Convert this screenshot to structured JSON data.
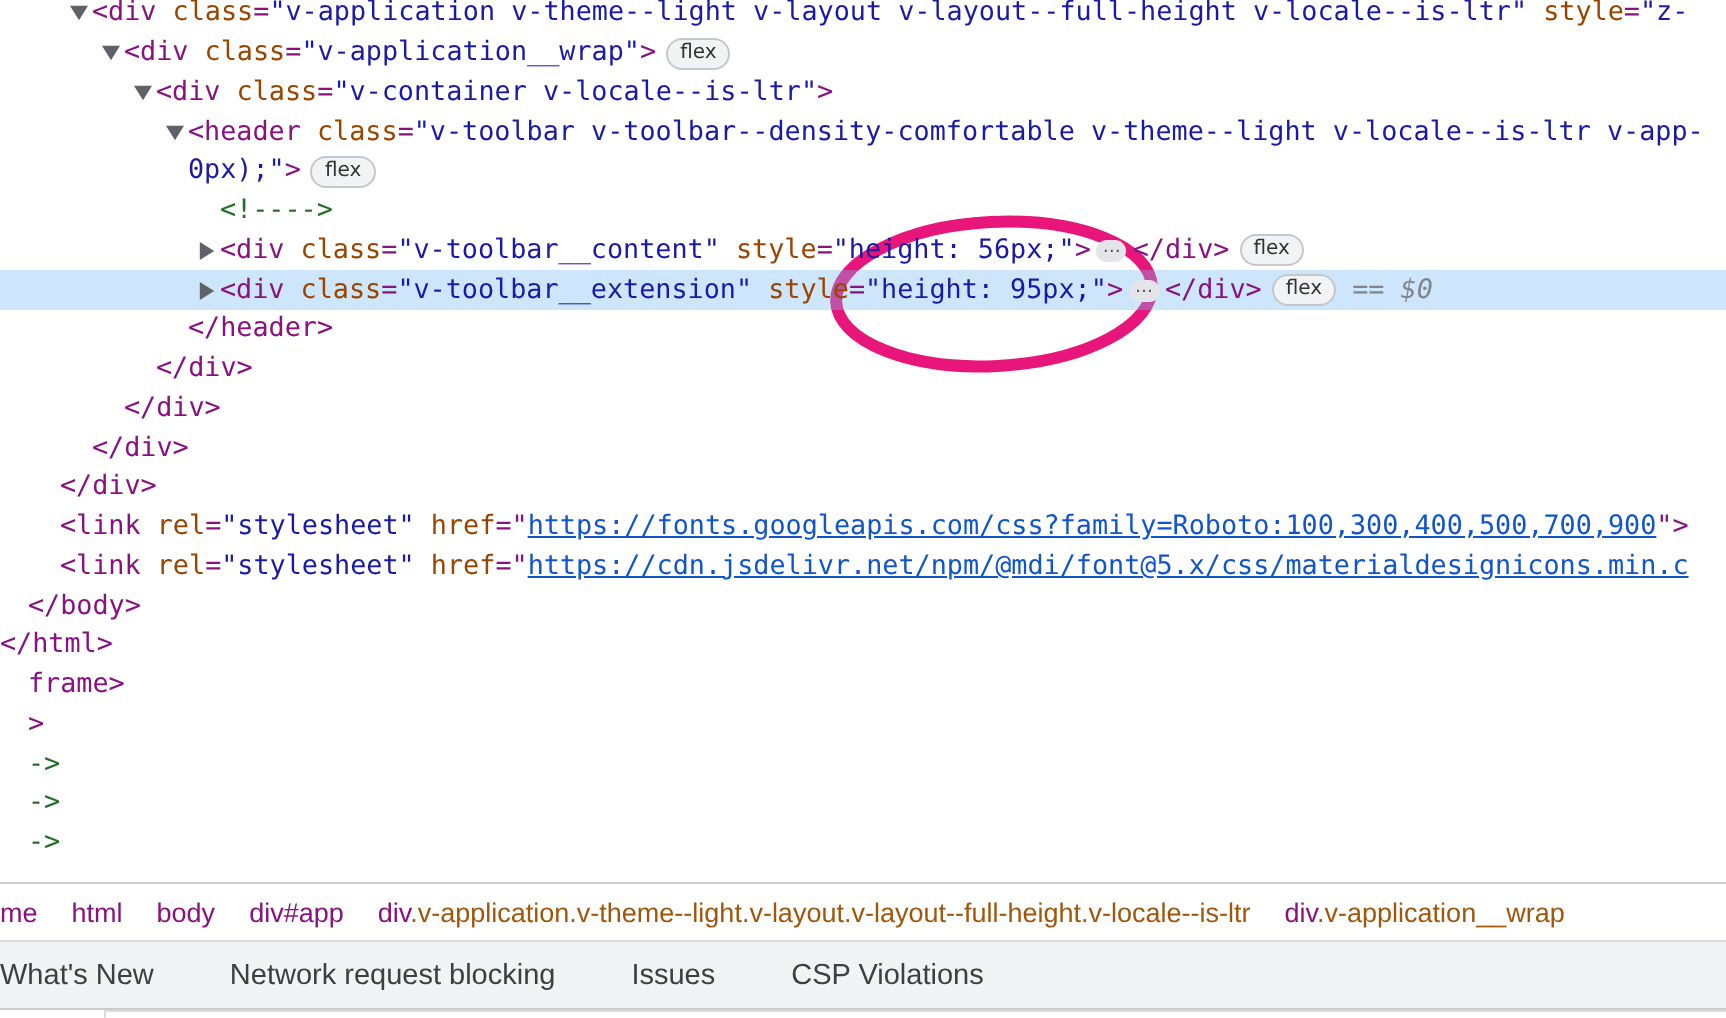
{
  "tree": [
    {
      "close": [
        {
          "kind": "tag",
          "text": "</html>"
        }
      ],
      "children": [
        {
          "close": [
            {
              "kind": "tag",
              "text": "</body>"
            }
          ],
          "children": [
            {
              "close": [
                {
                  "kind": "tag",
                  "text": "</div>"
                }
              ],
              "children": [
                {
                  "selected": false,
                  "expanded": true,
                  "open": [
                    {
                      "kind": "tag",
                      "text": "<div"
                    },
                    {
                      "kind": "attr",
                      "text": " class"
                    },
                    {
                      "kind": "tag",
                      "text": "="
                    },
                    {
                      "kind": "value",
                      "text": "\"v-application v-theme--light v-layout v-layout--full-height v-locale--is-ltr\""
                    },
                    {
                      "kind": "attr",
                      "text": " style"
                    },
                    {
                      "kind": "tag",
                      "text": "="
                    },
                    {
                      "kind": "value",
                      "text": "\"z-"
                    }
                  ],
                  "close": [
                    {
                      "kind": "tag",
                      "text": "</div>"
                    }
                  ],
                  "children": [
                    {
                      "selected": false,
                      "expanded": true,
                      "open": [
                        {
                          "kind": "tag",
                          "text": "<div"
                        },
                        {
                          "kind": "attr",
                          "text": " class"
                        },
                        {
                          "kind": "tag",
                          "text": "="
                        },
                        {
                          "kind": "value",
                          "text": "\"v-application__wrap\""
                        },
                        {
                          "kind": "tag",
                          "text": ">"
                        },
                        {
                          "kind": "badge",
                          "text": "flex"
                        }
                      ],
                      "close": [
                        {
                          "kind": "tag",
                          "text": "</div>"
                        }
                      ],
                      "children": [
                        {
                          "selected": false,
                          "expanded": true,
                          "open": [
                            {
                              "kind": "tag",
                              "text": "<div"
                            },
                            {
                              "kind": "attr",
                              "text": " class"
                            },
                            {
                              "kind": "tag",
                              "text": "="
                            },
                            {
                              "kind": "value",
                              "text": "\"v-container v-locale--is-ltr\""
                            },
                            {
                              "kind": "tag",
                              "text": ">"
                            }
                          ],
                          "close": [
                            {
                              "kind": "tag",
                              "text": "</div>"
                            }
                          ],
                          "children": [
                            {
                              "selected": false,
                              "expanded": true,
                              "open": [
                                {
                                  "kind": "tag",
                                  "text": "<header"
                                },
                                {
                                  "kind": "attr",
                                  "text": " class"
                                },
                                {
                                  "kind": "tag",
                                  "text": "="
                                },
                                {
                                  "kind": "value",
                                  "text": "\"v-toolbar v-toolbar--density-comfortable v-theme--light v-locale--is-ltr v-app-"
                                }
                              ],
                              "open_continued": [
                                {
                                  "kind": "value",
                                  "text": "0px);\""
                                },
                                {
                                  "kind": "tag",
                                  "text": ">"
                                },
                                {
                                  "kind": "badge",
                                  "text": "flex"
                                }
                              ],
                              "close": [
                                {
                                  "kind": "tag",
                                  "text": "</header>"
                                }
                              ],
                              "children": [
                                {
                                  "selected": false,
                                  "open": [
                                    {
                                      "kind": "comment",
                                      "text": "<!---->"
                                    }
                                  ]
                                },
                                {
                                  "selected": false,
                                  "expanded": false,
                                  "open": [
                                    {
                                      "kind": "tag",
                                      "text": "<div"
                                    },
                                    {
                                      "kind": "attr",
                                      "text": " class"
                                    },
                                    {
                                      "kind": "tag",
                                      "text": "="
                                    },
                                    {
                                      "kind": "value",
                                      "text": "\"v-toolbar__content\""
                                    },
                                    {
                                      "kind": "attr",
                                      "text": " style"
                                    },
                                    {
                                      "kind": "tag",
                                      "text": "="
                                    },
                                    {
                                      "kind": "value",
                                      "text": "\"height: 56px;\""
                                    },
                                    {
                                      "kind": "tag",
                                      "text": ">"
                                    },
                                    {
                                      "kind": "ellipsis",
                                      "text": "…"
                                    },
                                    {
                                      "kind": "tag",
                                      "text": "</div>"
                                    },
                                    {
                                      "kind": "badge",
                                      "text": "flex"
                                    }
                                  ]
                                },
                                {
                                  "selected": true,
                                  "expanded": false,
                                  "open": [
                                    {
                                      "kind": "tag",
                                      "text": "<div"
                                    },
                                    {
                                      "kind": "attr",
                                      "text": " class"
                                    },
                                    {
                                      "kind": "tag",
                                      "text": "="
                                    },
                                    {
                                      "kind": "value",
                                      "text": "\"v-toolbar__extension\""
                                    },
                                    {
                                      "kind": "attr",
                                      "text": " style"
                                    },
                                    {
                                      "kind": "tag",
                                      "text": "="
                                    },
                                    {
                                      "kind": "value",
                                      "text": "\"height: 95px;\""
                                    },
                                    {
                                      "kind": "tag",
                                      "text": ">"
                                    },
                                    {
                                      "kind": "ellipsis",
                                      "text": "…"
                                    },
                                    {
                                      "kind": "tag",
                                      "text": "</div>"
                                    },
                                    {
                                      "kind": "badge",
                                      "text": "flex"
                                    },
                                    {
                                      "kind": "ref",
                                      "text": "== $0"
                                    }
                                  ]
                                }
                              ]
                            }
                          ]
                        }
                      ]
                    }
                  ]
                }
              ]
            },
            {
              "selected": false,
              "open": [
                {
                  "kind": "tag",
                  "text": "<link"
                },
                {
                  "kind": "attr",
                  "text": " rel"
                },
                {
                  "kind": "tag",
                  "text": "="
                },
                {
                  "kind": "value",
                  "text": "\"stylesheet\""
                },
                {
                  "kind": "attr",
                  "text": " href"
                },
                {
                  "kind": "tag",
                  "text": "=\""
                },
                {
                  "kind": "link",
                  "text": "https://fonts.googleapis.com/css?family=Roboto:100,300,400,500,700,900"
                },
                {
                  "kind": "tag",
                  "text": "\">"
                }
              ]
            },
            {
              "selected": false,
              "open": [
                {
                  "kind": "tag",
                  "text": "<link"
                },
                {
                  "kind": "attr",
                  "text": " rel"
                },
                {
                  "kind": "tag",
                  "text": "="
                },
                {
                  "kind": "value",
                  "text": "\"stylesheet\""
                },
                {
                  "kind": "attr",
                  "text": " href"
                },
                {
                  "kind": "tag",
                  "text": "=\""
                },
                {
                  "kind": "link",
                  "text": "https://cdn.jsdelivr.net/npm/@mdi/font@5.x/css/materialdesignicons.min.c"
                }
              ]
            }
          ]
        }
      ]
    },
    {
      "selected": false,
      "open": [
        {
          "kind": "tag",
          "text": "frame>"
        }
      ]
    },
    {
      "selected": false,
      "open": [
        {
          "kind": "tag",
          "text": ">"
        }
      ]
    },
    {
      "selected": false,
      "open": [
        {
          "kind": "comment",
          "text": "->"
        }
      ]
    },
    {
      "selected": false,
      "open": [
        {
          "kind": "comment",
          "text": "->"
        }
      ]
    },
    {
      "selected": false,
      "open": [
        {
          "kind": "comment",
          "text": "->"
        }
      ]
    }
  ],
  "breadcrumbs": [
    {
      "tag": "me"
    },
    {
      "tag": "html"
    },
    {
      "tag": "body"
    },
    {
      "tag": "div#app"
    },
    {
      "tag": "div",
      "rest": ".v-application.v-theme--light.v-layout.v-layout--full-height.v-locale--is-ltr"
    },
    {
      "tag": "div",
      "rest": ".v-application__wrap"
    }
  ],
  "drawer_tabs": [
    "What's New",
    "Network request blocking",
    "Issues",
    "CSP Violations"
  ]
}
